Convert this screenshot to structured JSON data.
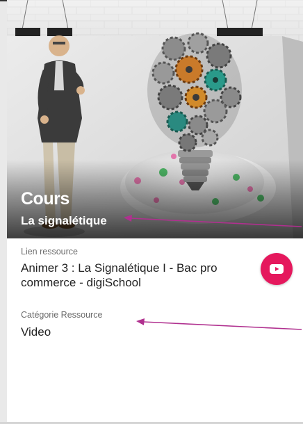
{
  "card": {
    "title": "Cours",
    "subtitle": "La signalétique"
  },
  "resource": {
    "link_label": "Lien ressource",
    "link_text": "Animer 3 : La Signalétique I - Bac pro commerce - digiSchool",
    "category_label": "Catégorie Ressource",
    "category_value": "Video",
    "icon": "youtube-icon"
  },
  "colors": {
    "accent": "#e5185d",
    "arrow": "#b0308f"
  }
}
